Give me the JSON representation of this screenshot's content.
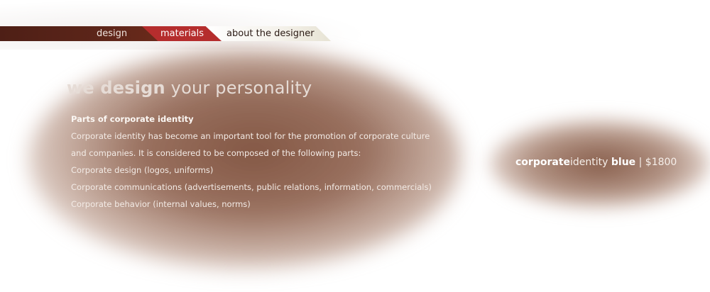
{
  "nav": {
    "items": [
      {
        "label": "design"
      },
      {
        "label": "materials"
      },
      {
        "label": "about the designer"
      }
    ]
  },
  "headline": {
    "bold": "we design",
    "rest": " your personality"
  },
  "content": {
    "heading": "Parts of corporate identity",
    "lines": [
      "Corporate identity has become an important tool for the promotion of corporate culture",
      "and companies. It is considered to be composed of the following parts:",
      "Corporate design (logos, uniforms)",
      "Corporate communications (advertisements, public relations, information, commercials)",
      "Corporate behavior (internal values, norms)"
    ]
  },
  "product": {
    "name_bold": "corporate",
    "name_rest": "identity",
    "color": "blue",
    "separator": " | ",
    "price": "$1800"
  },
  "colors": {
    "nav_dark": "#5c2519",
    "nav_active": "#b52d2d",
    "nav_light": "#f4f1ea",
    "glow": "#8a5c48"
  }
}
